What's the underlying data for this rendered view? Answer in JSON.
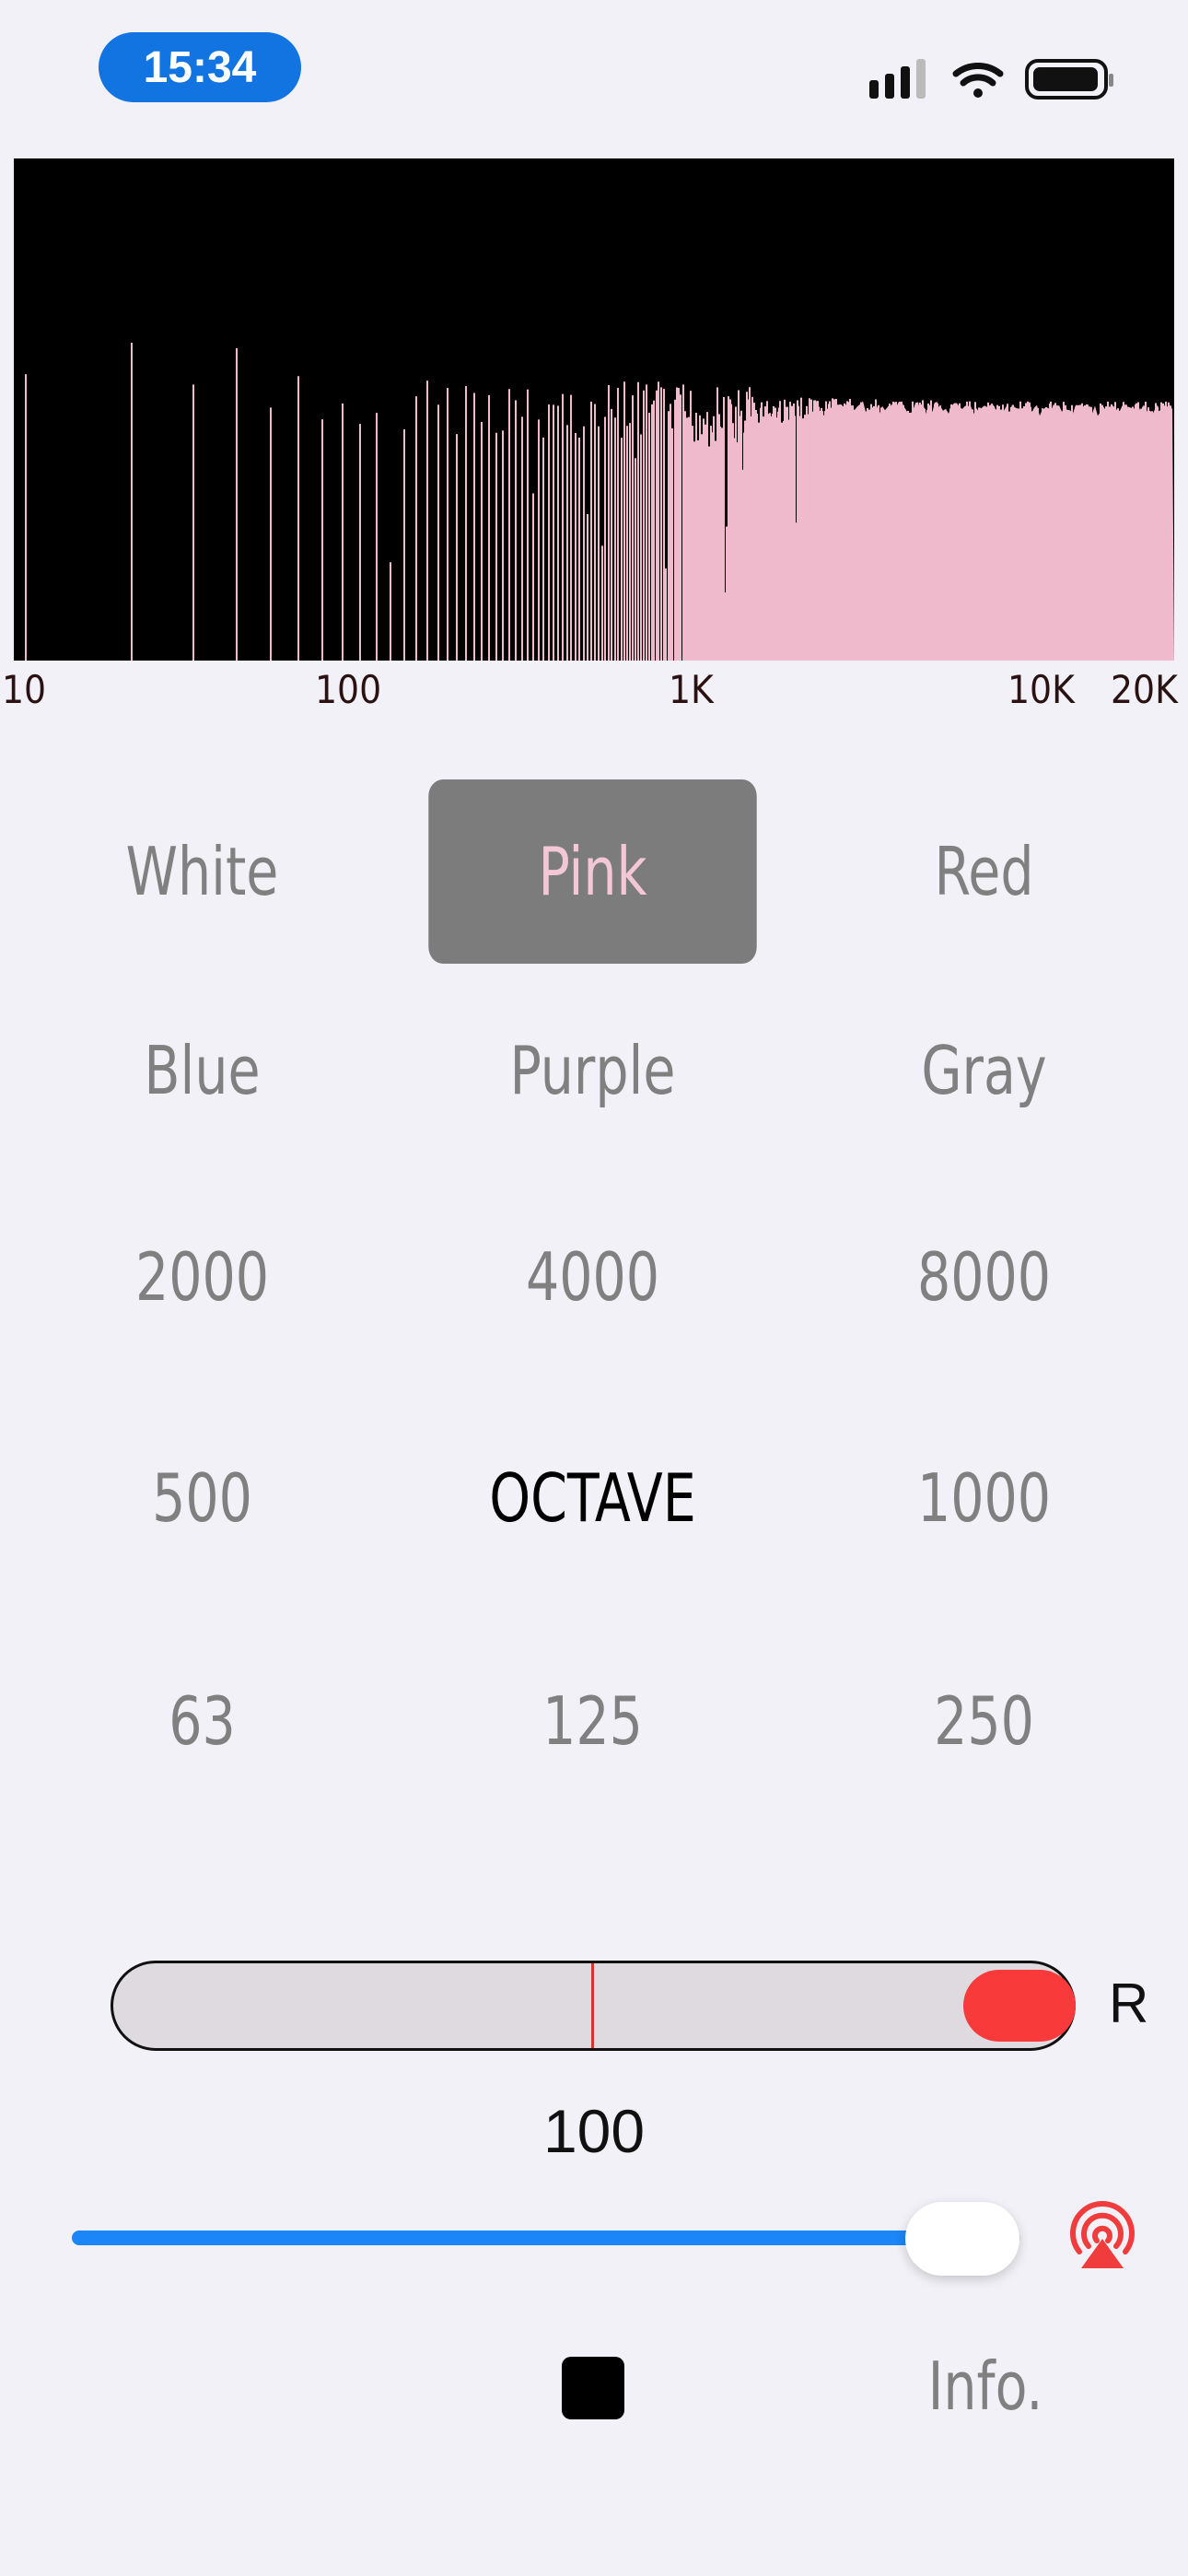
{
  "status_bar": {
    "time": "15:34"
  },
  "spectrum": {
    "axis_labels": [
      "10",
      "100",
      "1K",
      "10K",
      "20K"
    ],
    "bar_color": "#EFBBCC"
  },
  "noise_colors": [
    "White",
    "Pink",
    "Red",
    "Blue",
    "Purple",
    "Gray"
  ],
  "selected_noise": "Pink",
  "bands": {
    "row1": [
      "2000",
      "4000",
      "8000"
    ],
    "row2": [
      "500",
      "OCTAVE",
      "1000"
    ],
    "row3": [
      "63",
      "125",
      "250"
    ]
  },
  "balance": {
    "side_label": "R",
    "level": "100",
    "position": 1.0
  },
  "volume": {
    "fraction": 0.93
  },
  "info_label": "Info.",
  "colors": {
    "accent_blue": "#1A86F8",
    "balance_red": "#F83A3A",
    "pink": "#EFBBCC"
  }
}
